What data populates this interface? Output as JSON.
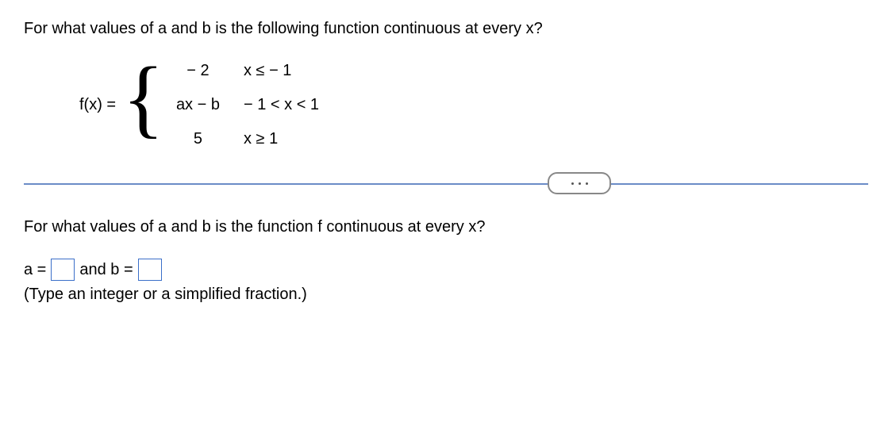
{
  "question": "For what values of a and b is the following function continuous at every x?",
  "piecewise": {
    "label": "f(x) =",
    "cases": [
      {
        "value": "− 2",
        "condition": "x ≤ − 1"
      },
      {
        "value": "ax − b",
        "condition": "− 1 < x < 1"
      },
      {
        "value": "5",
        "condition": "x ≥ 1"
      }
    ]
  },
  "followup": "For what values of a and b is the function f continuous at every x?",
  "answer": {
    "a_label": "a =",
    "and_label": "and b =",
    "a_value": "",
    "b_value": ""
  },
  "hint": "(Type an integer or a simplified fraction.)"
}
